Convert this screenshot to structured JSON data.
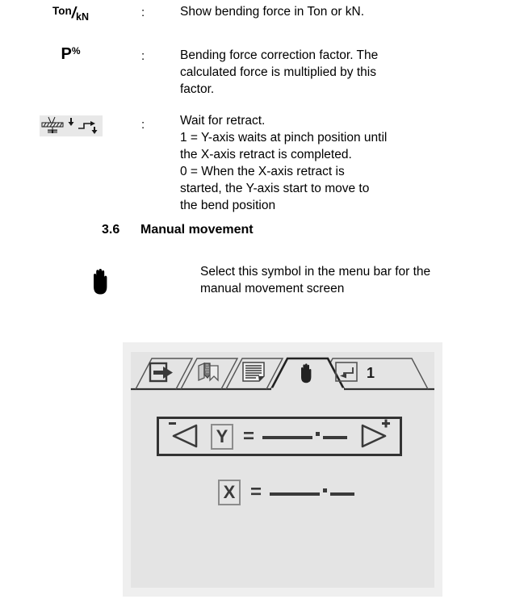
{
  "legend": {
    "colon": ":",
    "rows": [
      {
        "symbol_name": "ton-kn-symbol",
        "symbol_main": "Ton",
        "symbol_slash": "/",
        "symbol_sub": "kN",
        "description": [
          "Show bending force in Ton or kN."
        ]
      },
      {
        "symbol_name": "p-percent-symbol",
        "symbol_main": "P",
        "symbol_sub": "%",
        "description": [
          "Bending force correction factor. The",
          "calculated force is multiplied by this",
          "factor."
        ]
      },
      {
        "symbol_name": "wait-for-retract-symbol",
        "description": [
          "Wait for retract.",
          "1 = Y-axis waits at pinch position until",
          "the X-axis retract is completed.",
          "0 = When the X-axis retract is",
          "started, the Y-axis start to move to",
          "the bend position"
        ]
      }
    ]
  },
  "section": {
    "number": "3.6",
    "title": "Manual movement"
  },
  "hand_note": {
    "symbol_name": "hand-symbol",
    "description": [
      "Select this symbol in the menu bar for the",
      "manual movement screen"
    ]
  },
  "screen": {
    "tabs": [
      {
        "name": "tab-enter-program",
        "icon": "arrow-into-box-icon",
        "label": "",
        "active": false
      },
      {
        "name": "tab-tools",
        "icon": "tools-stack-icon",
        "label": "",
        "active": false
      },
      {
        "name": "tab-program-list",
        "icon": "document-lines-icon",
        "label": "",
        "active": false
      },
      {
        "name": "tab-manual-movement",
        "icon": "hand-icon",
        "label": "",
        "active": true
      },
      {
        "name": "tab-bend-step",
        "icon": "bend-return-icon",
        "label": "1",
        "active": false
      }
    ],
    "axes": [
      {
        "name": "y-axis-row",
        "label": "Y",
        "equals": "=",
        "value": "____.__",
        "decimal": ".",
        "minus_label": "-",
        "plus_label": "+",
        "has_jog_buttons": true
      },
      {
        "name": "x-axis-row",
        "label": "X",
        "equals": "=",
        "value": "____.__",
        "decimal": ".",
        "has_jog_buttons": false
      }
    ]
  },
  "colors": {
    "panel_outer": "#efefef",
    "panel_inner": "#e4e4e4",
    "ink": "#333333",
    "icon_gray": "#8c8c8c",
    "symbol_bg": "#e8e8e8"
  }
}
